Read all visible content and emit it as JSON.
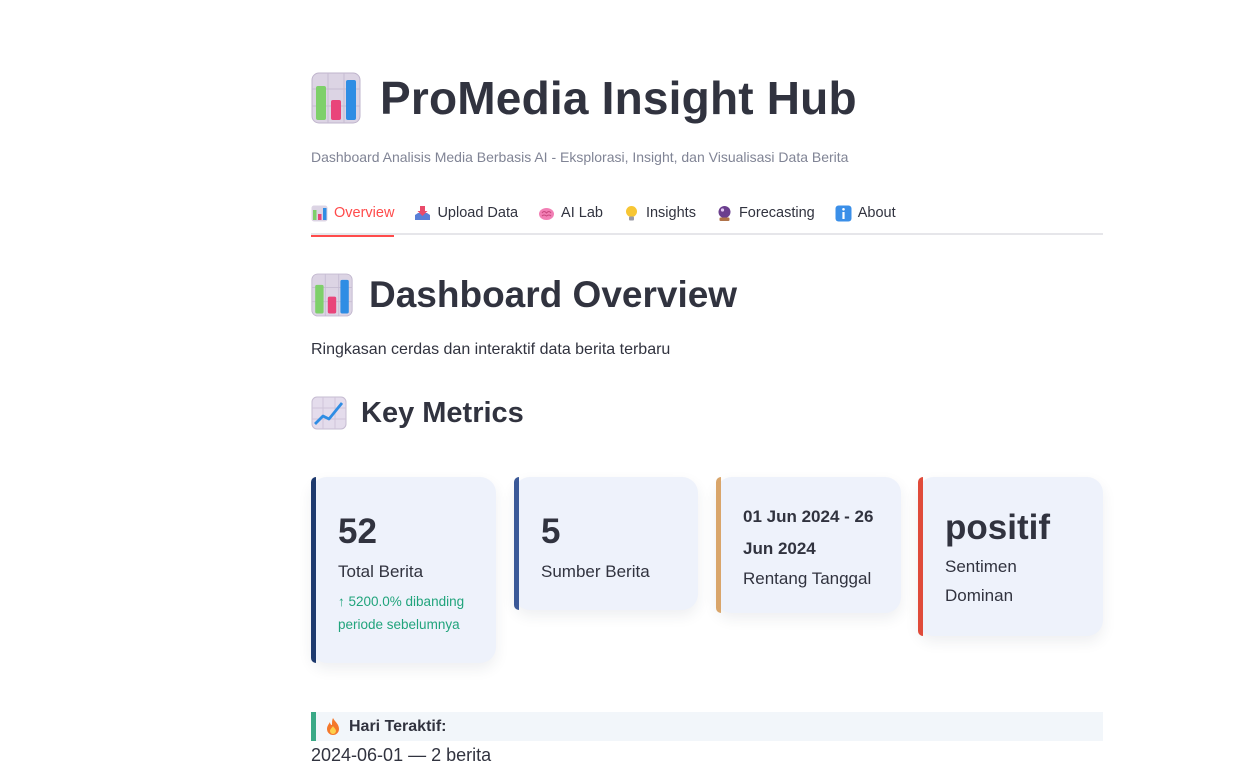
{
  "header": {
    "title": "ProMedia Insight Hub",
    "title_icon": "bar-chart-emoji",
    "subtitle": "Dashboard Analisis Media Berbasis AI - Eksplorasi, Insight, dan Visualisasi Data Berita"
  },
  "tabs": [
    {
      "label": "Overview",
      "icon": "bar-chart-emoji",
      "active": true
    },
    {
      "label": "Upload Data",
      "icon": "inbox-tray-emoji",
      "active": false
    },
    {
      "label": "AI Lab",
      "icon": "brain-emoji",
      "active": false
    },
    {
      "label": "Insights",
      "icon": "light-bulb-emoji",
      "active": false
    },
    {
      "label": "Forecasting",
      "icon": "crystal-ball-emoji",
      "active": false
    },
    {
      "label": "About",
      "icon": "info-emoji",
      "active": false
    }
  ],
  "overview": {
    "title": "Dashboard Overview",
    "intro": "Ringkasan cerdas dan interaktif data berita terbaru",
    "metrics_title": "Key Metrics"
  },
  "metrics": [
    {
      "value": "52",
      "label": "Total Berita",
      "delta": "↑ 5200.0% dibanding periode sebelumnya",
      "accent": "#1e3a6e"
    },
    {
      "value": "5",
      "label": "Sumber Berita",
      "accent": "#3b5998"
    },
    {
      "value": "01 Jun 2024 - 26 Jun 2024",
      "label": "Rentang Tanggal",
      "accent": "#d9a56a"
    },
    {
      "value": "positif",
      "label": "Sentimen Dominan",
      "accent": "#e04b3a"
    }
  ],
  "active_day": {
    "label": "Hari Teraktif:",
    "value": "2024-06-01 — 2 berita"
  },
  "colors": {
    "tab_active": "#ff4b4b",
    "delta_positive": "#21a47c",
    "card_bg": "#eef2fb"
  }
}
